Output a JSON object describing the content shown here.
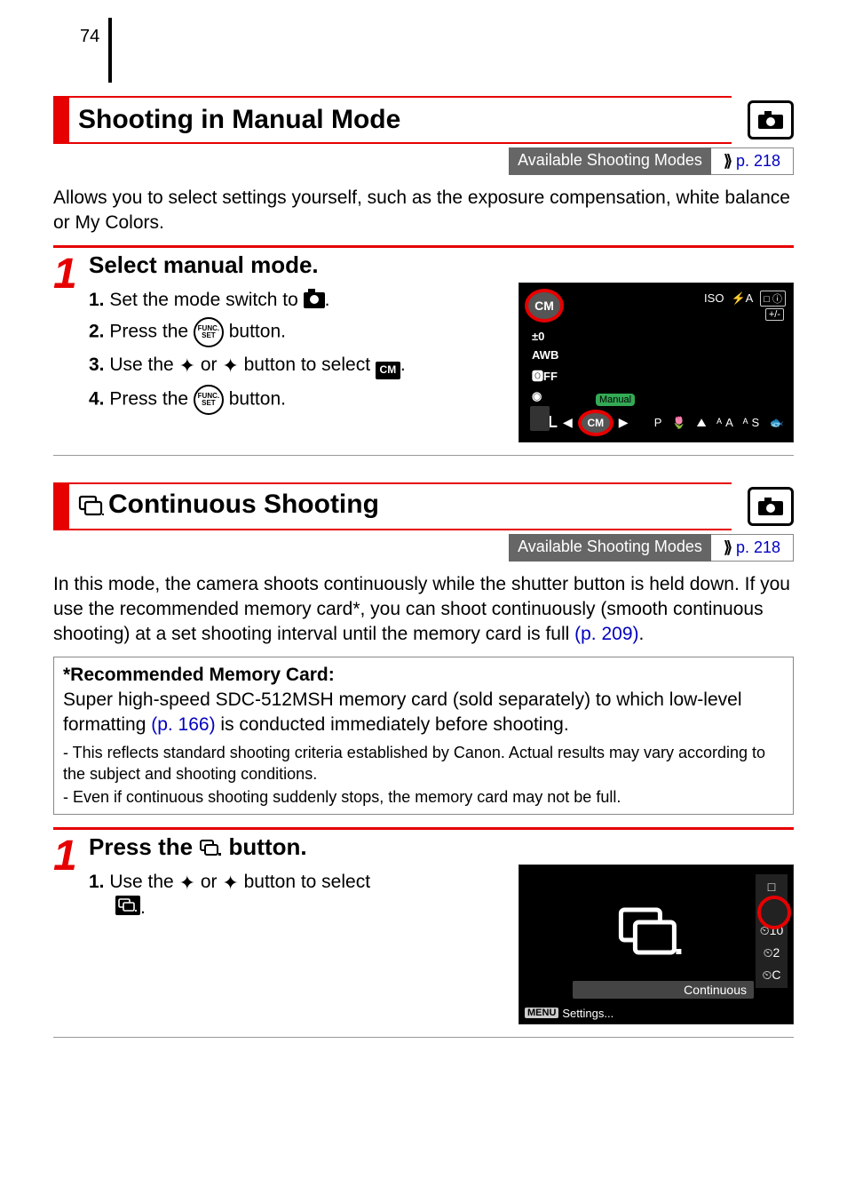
{
  "page_number": "74",
  "section1": {
    "title": "Shooting in Manual Mode",
    "available_label": "Available Shooting Modes",
    "available_ref": "p. 218",
    "intro": "Allows you to select settings yourself, such as the exposure compensation, white balance or My Colors.",
    "step_num": "1",
    "step_title": "Select manual mode.",
    "l1_a": "1.",
    "l1_b": " Set the mode switch to ",
    "l2_a": "2.",
    "l2_b": " Press the ",
    "l2_c": "  button.",
    "l3_a": "3.",
    "l3_b": " Use the ",
    "l3_c": " or ",
    "l3_d": " button to select ",
    "l4_a": "4.",
    "l4_b": " Press the ",
    "l4_c": "  button.",
    "lcd": {
      "om": "CM",
      "top_iso": "ISO",
      "top_flash": "⚡A",
      "top_box": "□ ⓘ",
      "top_exp": "+/-",
      "left_pm0": "±0",
      "left_awb": "AWB",
      "left_off": "🅾FF",
      "left_meter": "◉",
      "left_L": "L",
      "manual": "Manual",
      "bot_om": "CM",
      "bot_icons": "P 🌷 ⛰ ᴬA ᴬS 🐟"
    }
  },
  "section2": {
    "title": "Continuous Shooting",
    "available_label": "Available Shooting Modes",
    "available_ref": "p. 218",
    "intro_a": "In this mode, the camera shoots continuously while the shutter button is held down. If you use the recommended memory card*, you can shoot continuously (smooth continuous shooting) at a set shooting interval until the memory card is full ",
    "intro_ref": "(p. 209)",
    "intro_b": ".",
    "rec_title": "*Recommended Memory Card:",
    "rec_body_a": "Super high-speed SDC-512MSH memory card (sold separately) to which low-level formatting ",
    "rec_ref": "(p. 166)",
    "rec_body_b": " is conducted immediately before shooting.",
    "note1": "- This reflects standard shooting criteria established by Canon. Actual results may vary according to the subject and shooting conditions.",
    "note2": "- Even if continuous shooting suddenly stops, the memory card may not be full.",
    "step_num": "1",
    "step_title_a": "Press the ",
    "step_title_b": " button.",
    "l1_a": "1.",
    "l1_b": " Use the ",
    "l1_c": " or ",
    "l1_d": " button to select ",
    "lcd": {
      "single": "□",
      "timer10": "⏲10",
      "timer2": "⏲2",
      "timerC": "⏲C",
      "cont_label": "Continuous",
      "menu_pill": "MENU",
      "menu_text": "Settings..."
    }
  }
}
